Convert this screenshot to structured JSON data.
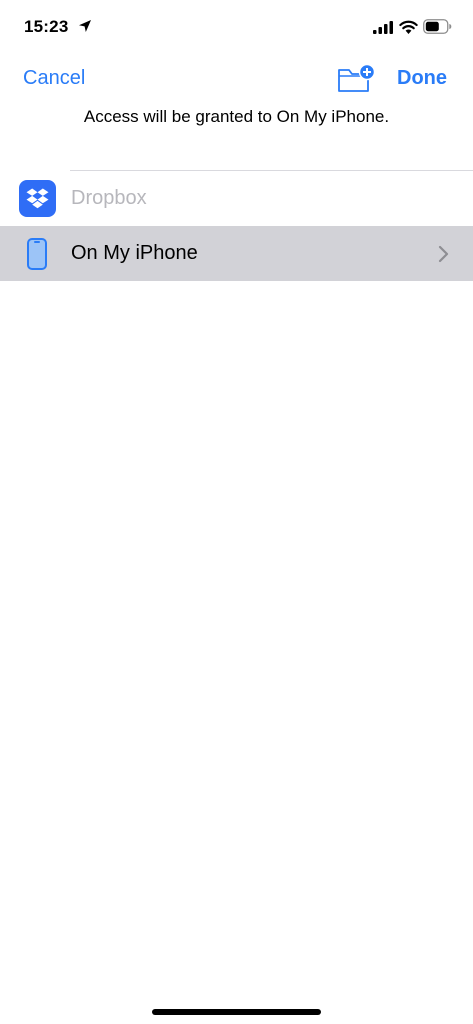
{
  "status_bar": {
    "time": "15:23",
    "icons": [
      "location-arrow-icon",
      "cellular-signal-icon",
      "wifi-icon",
      "battery-icon"
    ]
  },
  "nav": {
    "cancel_label": "Cancel",
    "done_label": "Done",
    "new_folder_icon": "folder-plus-icon",
    "prompt": "Access will be granted to On My iPhone."
  },
  "locations": [
    {
      "label": "Dropbox",
      "icon": "dropbox-icon",
      "state": "disabled"
    },
    {
      "label": "On My iPhone",
      "icon": "iphone-icon",
      "state": "selected",
      "accessory": "chevron-right-icon"
    }
  ],
  "colors": {
    "accent": "#2a7cf7",
    "selected_row": "#d2d2d7",
    "disabled_text": "#b7b7bc",
    "dropbox_brand": "#2f6df6"
  }
}
